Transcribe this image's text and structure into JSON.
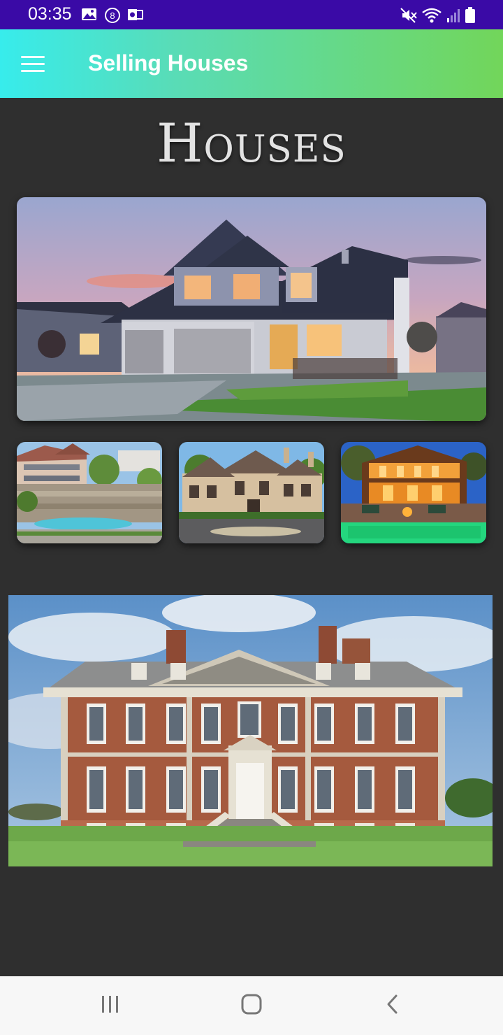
{
  "status_bar": {
    "time": "03:35",
    "left_icons": [
      "gallery-icon",
      "notification-8-icon",
      "outlook-icon"
    ],
    "right_icons": [
      "mute-icon",
      "wifi-icon",
      "signal-icon",
      "battery-icon"
    ]
  },
  "app_bar": {
    "title": "Selling Houses",
    "menu_icon": "hamburger-menu-icon",
    "gradient": [
      "#37ecec",
      "#72d65a"
    ]
  },
  "page": {
    "heading": "Houses",
    "background": "#2f2f2f"
  },
  "gallery": {
    "featured": "modern-house-at-sunset",
    "thumbnails": [
      "hillside-villa-with-pool",
      "stone-mansion-with-driveway",
      "lit-lodge-with-pool-at-night"
    ],
    "bottom_image": "brick-georgian-manor"
  },
  "nav_bar": {
    "buttons": [
      "recent-apps-icon",
      "home-icon",
      "back-icon"
    ]
  }
}
